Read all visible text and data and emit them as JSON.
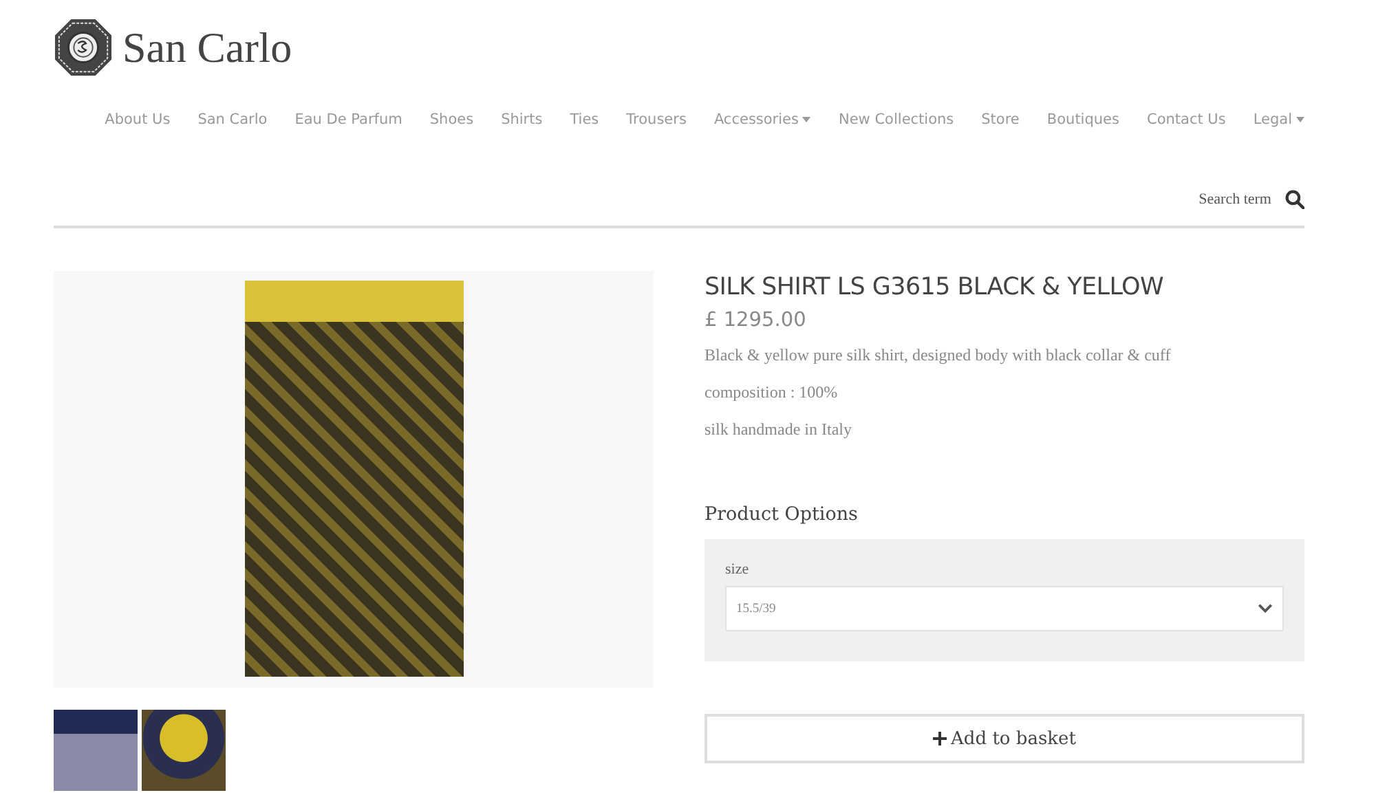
{
  "brand": {
    "name": "San Carlo"
  },
  "nav": [
    {
      "label": "About Us",
      "has_menu": false
    },
    {
      "label": "San Carlo",
      "has_menu": false
    },
    {
      "label": "Eau De Parfum",
      "has_menu": false
    },
    {
      "label": "Shoes",
      "has_menu": false
    },
    {
      "label": "Shirts",
      "has_menu": false
    },
    {
      "label": "Ties",
      "has_menu": false
    },
    {
      "label": "Trousers",
      "has_menu": false
    },
    {
      "label": "Accessories",
      "has_menu": true
    },
    {
      "label": "New Collections",
      "has_menu": false
    },
    {
      "label": "Store",
      "has_menu": false
    },
    {
      "label": "Boutiques",
      "has_menu": false
    },
    {
      "label": "Contact Us",
      "has_menu": false
    },
    {
      "label": "Legal",
      "has_menu": true
    }
  ],
  "search": {
    "placeholder": "Search term"
  },
  "product": {
    "title": "SILK SHIRT LS G3615 BLACK & YELLOW",
    "price": "£ 1295.00",
    "description": [
      "Black & yellow pure silk shirt, designed body with black collar & cuff",
      "composition : 100%",
      "silk handmade in Italy"
    ]
  },
  "options": {
    "heading": "Product Options",
    "fields": [
      {
        "label": "size",
        "value": "15.5/39"
      }
    ]
  },
  "add_button": {
    "label": "Add to basket"
  }
}
